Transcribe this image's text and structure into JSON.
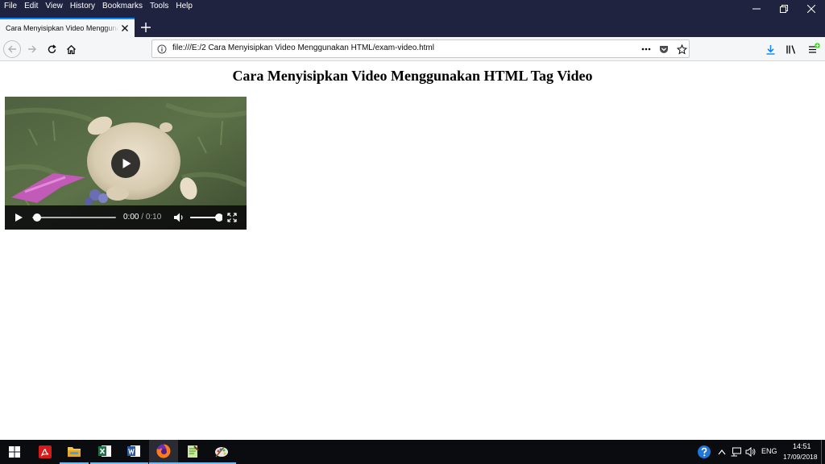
{
  "browser": {
    "menu": [
      "File",
      "Edit",
      "View",
      "History",
      "Bookmarks",
      "Tools",
      "Help"
    ],
    "tab": {
      "title": "Cara Menyisipkan Video Menggunakan HTML Tag Video"
    },
    "url": "file:///E:/2 Cara Menyisipkan Video Menggunakan HTML/exam-video.html",
    "accent_color": "#0a84ff"
  },
  "page": {
    "heading": "Cara Menyisipkan Video Menggunakan HTML Tag Video"
  },
  "video": {
    "current_time": "0:00",
    "separator": " / ",
    "duration": "0:10",
    "progress_fraction": 0.0,
    "volume_fraction": 1.0
  },
  "taskbar": {
    "apps": [
      "start-icon",
      "acrobat-icon",
      "file-explorer-icon",
      "excel-icon",
      "word-icon",
      "firefox-icon",
      "notepad-plus-plus-icon",
      "paint-icon"
    ],
    "language": "ENG",
    "time": "14:51",
    "date": "17/09/2018"
  }
}
